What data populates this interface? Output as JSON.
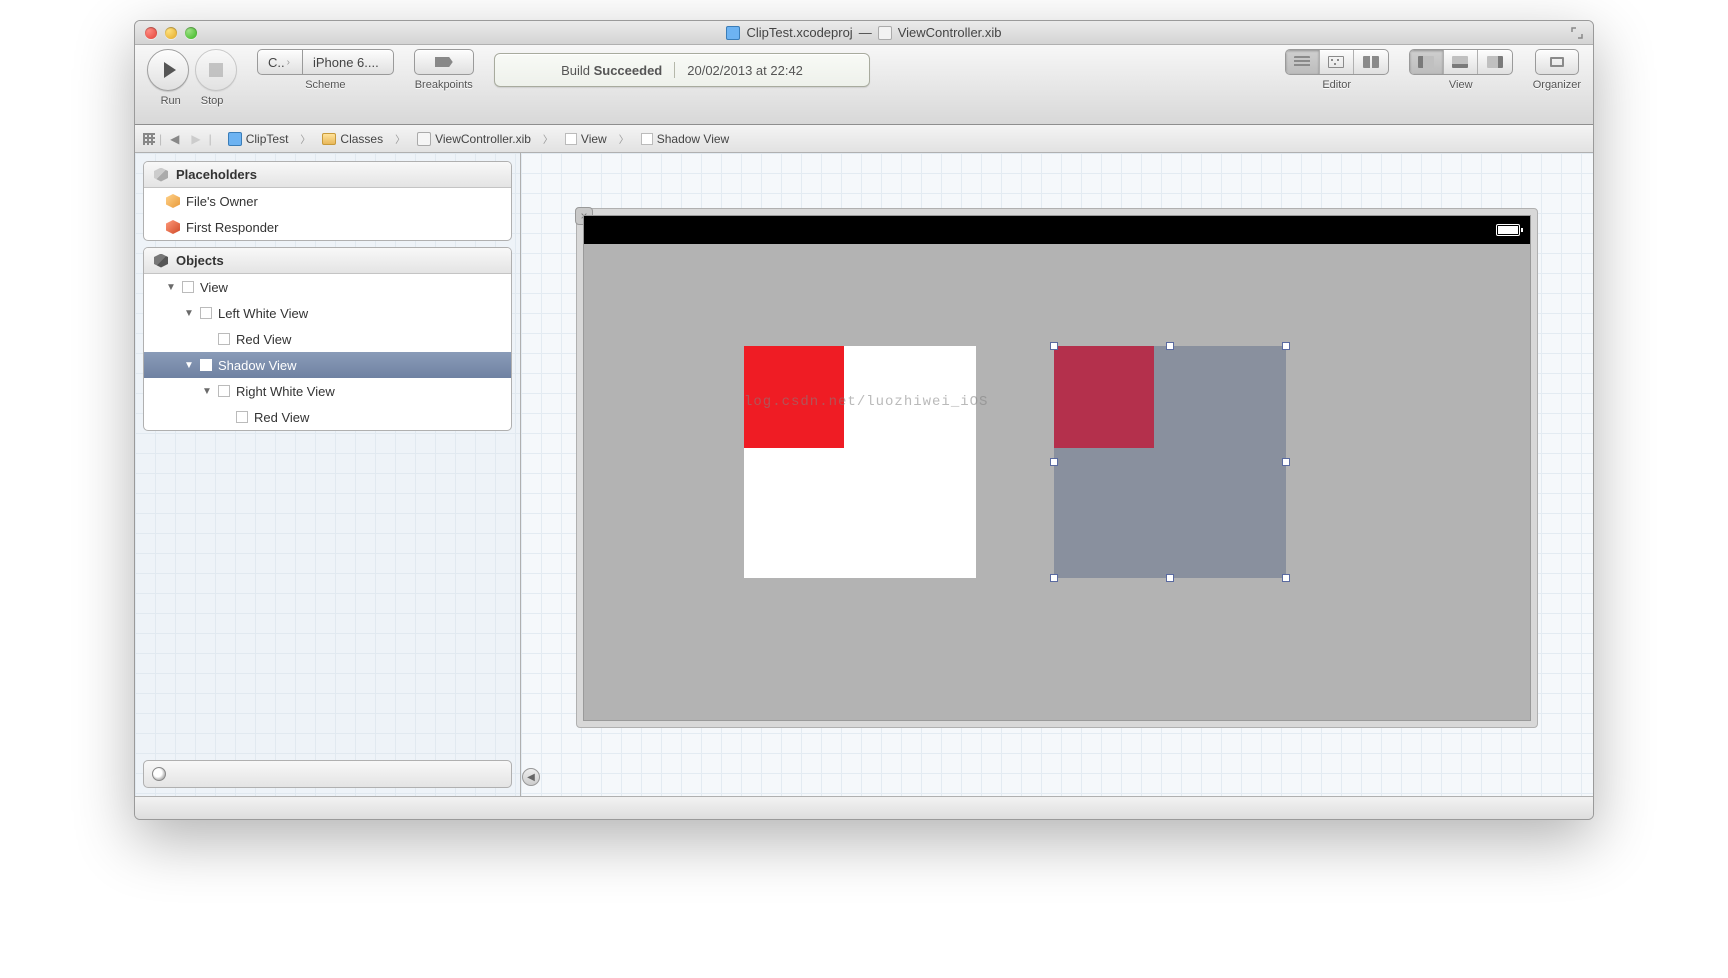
{
  "window": {
    "project_file": "ClipTest.xcodeproj",
    "separator": "—",
    "document_file": "ViewController.xib"
  },
  "toolbar": {
    "run_label": "Run",
    "stop_label": "Stop",
    "scheme_label": "Scheme",
    "scheme_project": "C..",
    "scheme_device": "iPhone 6....",
    "breakpoints_label": "Breakpoints",
    "editor_label": "Editor",
    "view_label": "View",
    "organizer_label": "Organizer"
  },
  "status": {
    "build_prefix": "Build ",
    "build_result": "Succeeded",
    "timestamp": "20/02/2013 at 22:42"
  },
  "path": {
    "segments": [
      {
        "label": "ClipTest",
        "icon": "project"
      },
      {
        "label": "Classes",
        "icon": "folder"
      },
      {
        "label": "ViewController.xib",
        "icon": "xib"
      },
      {
        "label": "View",
        "icon": "view"
      },
      {
        "label": "Shadow View",
        "icon": "view"
      }
    ]
  },
  "outline": {
    "placeholders_title": "Placeholders",
    "placeholders": [
      {
        "label": "File's Owner"
      },
      {
        "label": "First Responder"
      }
    ],
    "objects_title": "Objects",
    "objects": [
      {
        "label": "View",
        "level": 1,
        "expanded": true,
        "selected": false
      },
      {
        "label": "Left White View",
        "level": 2,
        "expanded": true,
        "selected": false
      },
      {
        "label": "Red View",
        "level": 3,
        "expanded": false,
        "selected": false,
        "leaf": true
      },
      {
        "label": "Shadow View",
        "level": 2,
        "expanded": true,
        "selected": true
      },
      {
        "label": "Right White View",
        "level": 3,
        "expanded": true,
        "selected": false
      },
      {
        "label": "Red View",
        "level": 4,
        "expanded": false,
        "selected": false,
        "leaf": true
      }
    ]
  },
  "canvas": {
    "watermark": "log.csdn.net/luozhiwei_iOS",
    "colors": {
      "left_white": "#ffffff",
      "left_red": "#ef1c24",
      "shadow_tint": "rgba(60,80,120,0.35)",
      "right_red_tinted": "#b4304c",
      "device_bg": "#b3b3b3"
    }
  }
}
